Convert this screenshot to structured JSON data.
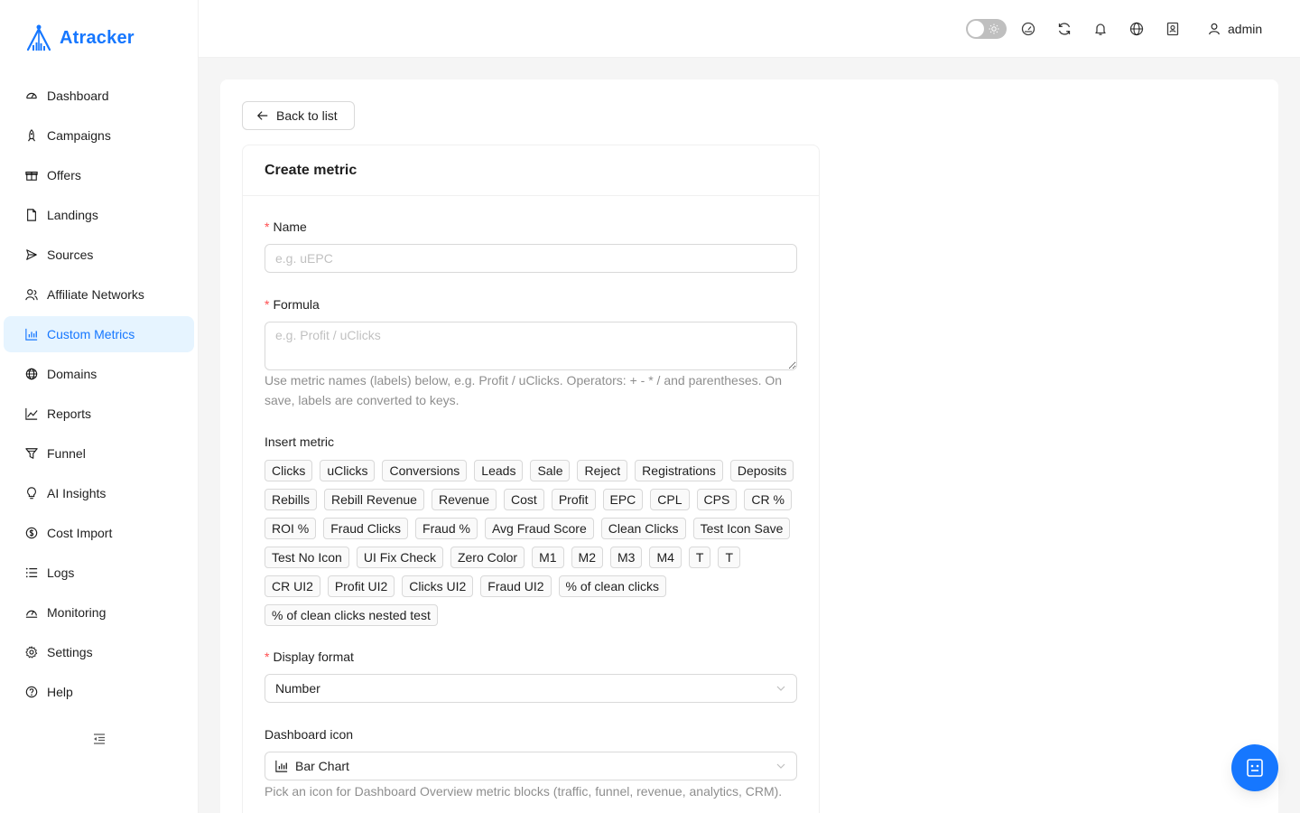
{
  "app": {
    "name": "Atracker",
    "accent": "#1677ff"
  },
  "sidebar": {
    "items": [
      {
        "label": "Dashboard",
        "icon": "dashboard-icon"
      },
      {
        "label": "Campaigns",
        "icon": "rocket-icon"
      },
      {
        "label": "Offers",
        "icon": "gift-icon"
      },
      {
        "label": "Landings",
        "icon": "file-icon"
      },
      {
        "label": "Sources",
        "icon": "send-icon"
      },
      {
        "label": "Affiliate Networks",
        "icon": "team-icon"
      },
      {
        "label": "Custom Metrics",
        "icon": "bar-chart-icon",
        "active": true
      },
      {
        "label": "Domains",
        "icon": "globe-icon"
      },
      {
        "label": "Reports",
        "icon": "line-chart-icon"
      },
      {
        "label": "Funnel",
        "icon": "funnel-icon"
      },
      {
        "label": "AI Insights",
        "icon": "bulb-icon"
      },
      {
        "label": "Cost Import",
        "icon": "dollar-icon"
      },
      {
        "label": "Logs",
        "icon": "list-icon"
      },
      {
        "label": "Monitoring",
        "icon": "monitor-icon"
      },
      {
        "label": "Settings",
        "icon": "gear-icon"
      },
      {
        "label": "Help",
        "icon": "question-icon"
      }
    ]
  },
  "header": {
    "username": "admin"
  },
  "page": {
    "back_label": "Back to list",
    "card_title": "Create metric",
    "name": {
      "label": "Name",
      "placeholder": "e.g. uEPC",
      "value": ""
    },
    "formula": {
      "label": "Formula",
      "placeholder": "e.g. Profit / uClicks",
      "value": "",
      "help": "Use metric names (labels) below, e.g. Profit / uClicks. Operators: + - * / and parentheses. On save, labels are converted to keys."
    },
    "insert_metric": {
      "label": "Insert metric",
      "tags": [
        "Clicks",
        "uClicks",
        "Conversions",
        "Leads",
        "Sale",
        "Reject",
        "Registrations",
        "Deposits",
        "Rebills",
        "Rebill Revenue",
        "Revenue",
        "Cost",
        "Profit",
        "EPC",
        "CPL",
        "CPS",
        "CR %",
        "ROI %",
        "Fraud Clicks",
        "Fraud %",
        "Avg Fraud Score",
        "Clean Clicks",
        "Test Icon Save",
        "Test No Icon",
        "UI Fix Check",
        "Zero Color",
        "M1",
        "M2",
        "M3",
        "M4",
        "T",
        "T",
        "CR UI2",
        "Profit UI2",
        "Clicks UI2",
        "Fraud UI2",
        "% of clean clicks",
        "% of clean clicks nested test"
      ]
    },
    "display_format": {
      "label": "Display format",
      "value": "Number"
    },
    "dashboard_icon": {
      "label": "Dashboard icon",
      "value": "Bar Chart",
      "icon": "bar-chart-icon",
      "help": "Pick an icon for Dashboard Overview metric blocks (traffic, funnel, revenue, analytics, CRM)."
    }
  }
}
